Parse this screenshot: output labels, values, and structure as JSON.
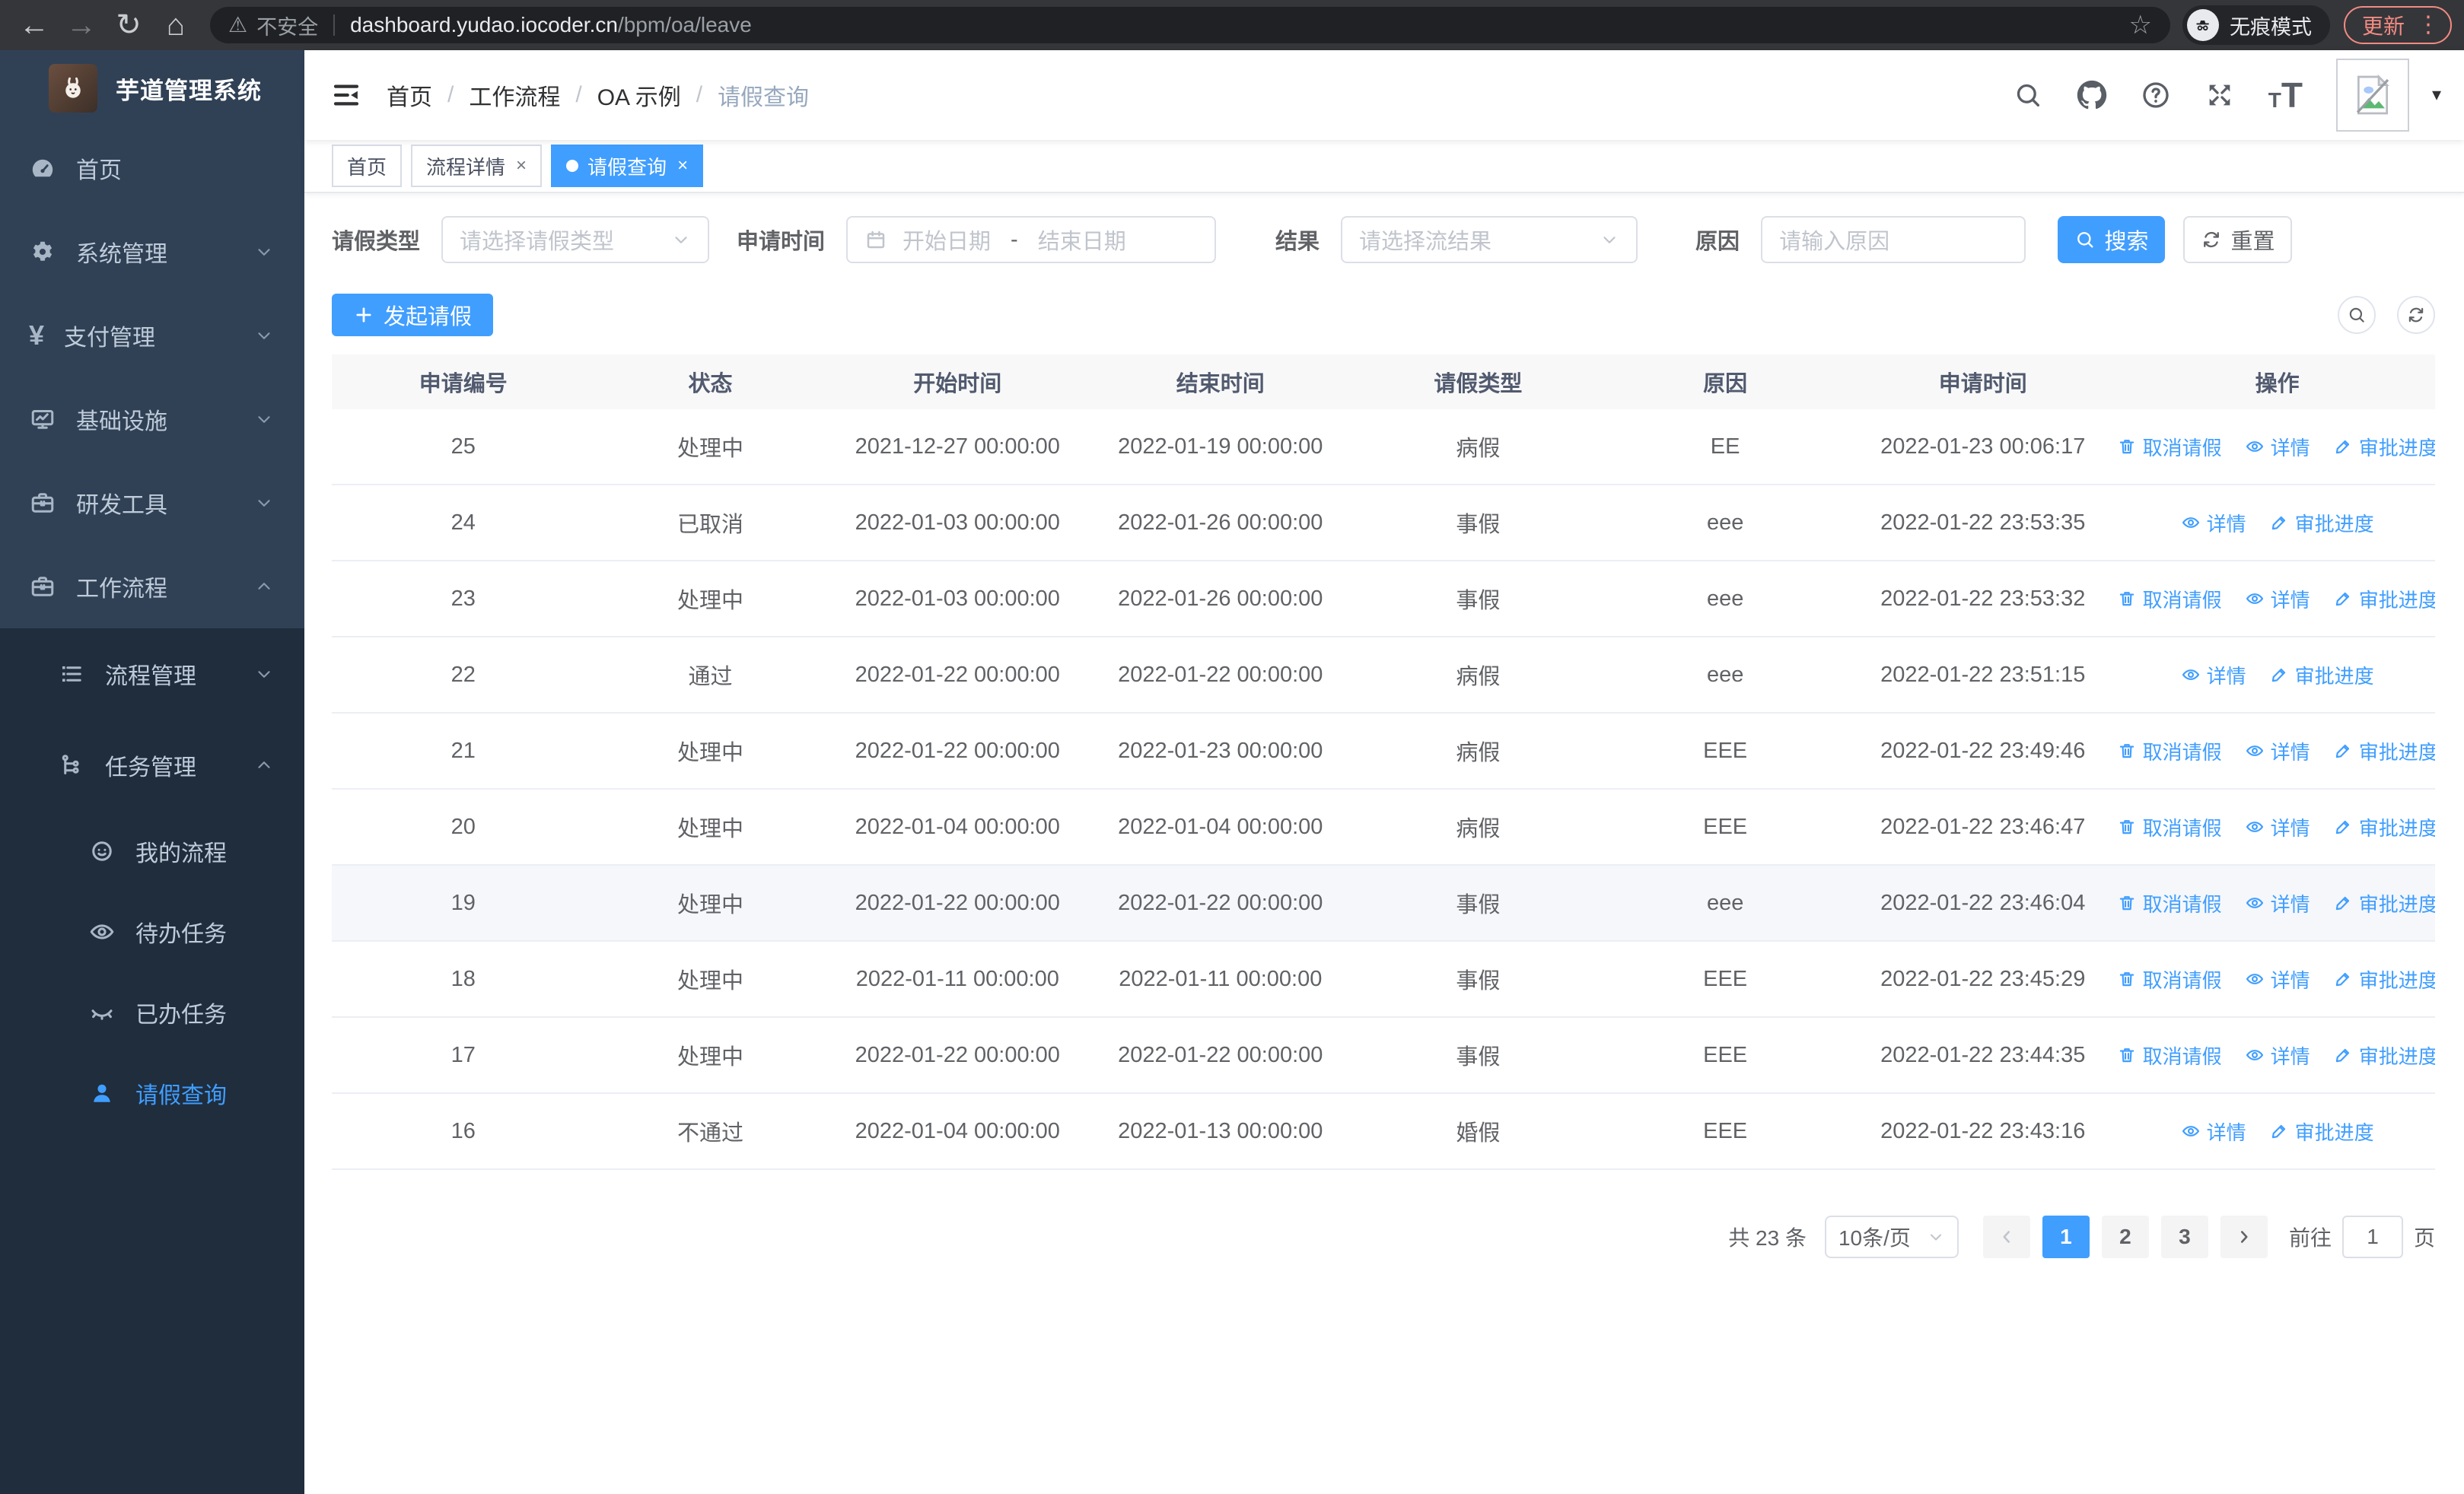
{
  "browser": {
    "security_warning": "不安全",
    "url_host": "dashboard.yudao.iocoder.cn",
    "url_path": "/bpm/oa/leave",
    "incognito_label": "无痕模式",
    "update_button": "更新"
  },
  "colors": {
    "accent_blue": "#409eff",
    "sidebar_bg": "#304156",
    "sidebar_submenu_bg": "#1f2d3d",
    "chrome_bg": "#35363a",
    "update_salmon": "#f28b82",
    "table_header_bg": "#f8f8f9",
    "row_highlight": "#f5f7fa"
  },
  "sidebar": {
    "title": "芋道管理系统",
    "menu": [
      {
        "key": "home",
        "label": "首页",
        "icon": "dashboard",
        "level": 1
      },
      {
        "key": "system",
        "label": "系统管理",
        "icon": "gear",
        "level": 1,
        "arrow": "down"
      },
      {
        "key": "payment",
        "label": "支付管理",
        "icon": "yen",
        "level": 1,
        "arrow": "down"
      },
      {
        "key": "infrastructure",
        "label": "基础设施",
        "icon": "monitor",
        "level": 1,
        "arrow": "down"
      },
      {
        "key": "dev-tools",
        "label": "研发工具",
        "icon": "briefcase",
        "level": 1,
        "arrow": "down"
      },
      {
        "key": "workflow",
        "label": "工作流程",
        "icon": "briefcase",
        "level": 1,
        "arrow": "up"
      },
      {
        "key": "process-mgmt",
        "label": "流程管理",
        "icon": "list",
        "level": 2,
        "arrow": "down",
        "dark": true
      },
      {
        "key": "task-mgmt",
        "label": "任务管理",
        "icon": "tree",
        "level": 2,
        "arrow": "up",
        "dark": true
      },
      {
        "key": "my-process",
        "label": "我的流程",
        "icon": "face",
        "level": 3,
        "dark": true
      },
      {
        "key": "todo-tasks",
        "label": "待办任务",
        "icon": "eye",
        "level": 3,
        "dark": true
      },
      {
        "key": "done-tasks",
        "label": "已办任务",
        "icon": "eye-closed",
        "level": 3,
        "dark": true
      },
      {
        "key": "leave-query",
        "label": "请假查询",
        "icon": "user",
        "level": 3,
        "dark": true,
        "active": true
      }
    ]
  },
  "header": {
    "breadcrumb": [
      "首页",
      "工作流程",
      "OA 示例",
      "请假查询"
    ],
    "breadcrumb_separator": "/"
  },
  "tags": [
    {
      "key": "home",
      "label": "首页",
      "closable": false,
      "active": false
    },
    {
      "key": "process-detail",
      "label": "流程详情",
      "closable": true,
      "active": false
    },
    {
      "key": "leave-query",
      "label": "请假查询",
      "closable": true,
      "active": true
    }
  ],
  "filters": {
    "leave_type_label": "请假类型",
    "leave_type_placeholder": "请选择请假类型",
    "apply_time_label": "申请时间",
    "date_start_placeholder": "开始日期",
    "date_separator": "-",
    "date_end_placeholder": "结束日期",
    "result_label": "结果",
    "result_placeholder": "请选择流结果",
    "reason_label": "原因",
    "reason_placeholder": "请输入原因",
    "search_button": "搜索",
    "reset_button": "重置"
  },
  "toolbar": {
    "create_button": "发起请假"
  },
  "table": {
    "columns": [
      "申请编号",
      "状态",
      "开始时间",
      "结束时间",
      "请假类型",
      "原因",
      "申请时间",
      "操作"
    ],
    "action_labels": {
      "cancel": "取消请假",
      "detail": "详情",
      "progress": "审批进度"
    },
    "rows": [
      {
        "id": "25",
        "status": "处理中",
        "start": "2021-12-27 00:00:00",
        "end": "2022-01-19 00:00:00",
        "type": "病假",
        "reason": "EE",
        "apply_time": "2022-01-23 00:06:17",
        "actions": [
          "cancel",
          "detail",
          "progress"
        ],
        "highlight": false
      },
      {
        "id": "24",
        "status": "已取消",
        "start": "2022-01-03 00:00:00",
        "end": "2022-01-26 00:00:00",
        "type": "事假",
        "reason": "eee",
        "apply_time": "2022-01-22 23:53:35",
        "actions": [
          "detail",
          "progress"
        ],
        "highlight": false
      },
      {
        "id": "23",
        "status": "处理中",
        "start": "2022-01-03 00:00:00",
        "end": "2022-01-26 00:00:00",
        "type": "事假",
        "reason": "eee",
        "apply_time": "2022-01-22 23:53:32",
        "actions": [
          "cancel",
          "detail",
          "progress"
        ],
        "highlight": false
      },
      {
        "id": "22",
        "status": "通过",
        "start": "2022-01-22 00:00:00",
        "end": "2022-01-22 00:00:00",
        "type": "病假",
        "reason": "eee",
        "apply_time": "2022-01-22 23:51:15",
        "actions": [
          "detail",
          "progress"
        ],
        "highlight": false
      },
      {
        "id": "21",
        "status": "处理中",
        "start": "2022-01-22 00:00:00",
        "end": "2022-01-23 00:00:00",
        "type": "病假",
        "reason": "EEE",
        "apply_time": "2022-01-22 23:49:46",
        "actions": [
          "cancel",
          "detail",
          "progress"
        ],
        "highlight": false
      },
      {
        "id": "20",
        "status": "处理中",
        "start": "2022-01-04 00:00:00",
        "end": "2022-01-04 00:00:00",
        "type": "病假",
        "reason": "EEE",
        "apply_time": "2022-01-22 23:46:47",
        "actions": [
          "cancel",
          "detail",
          "progress"
        ],
        "highlight": false
      },
      {
        "id": "19",
        "status": "处理中",
        "start": "2022-01-22 00:00:00",
        "end": "2022-01-22 00:00:00",
        "type": "事假",
        "reason": "eee",
        "apply_time": "2022-01-22 23:46:04",
        "actions": [
          "cancel",
          "detail",
          "progress"
        ],
        "highlight": true
      },
      {
        "id": "18",
        "status": "处理中",
        "start": "2022-01-11 00:00:00",
        "end": "2022-01-11 00:00:00",
        "type": "事假",
        "reason": "EEE",
        "apply_time": "2022-01-22 23:45:29",
        "actions": [
          "cancel",
          "detail",
          "progress"
        ],
        "highlight": false
      },
      {
        "id": "17",
        "status": "处理中",
        "start": "2022-01-22 00:00:00",
        "end": "2022-01-22 00:00:00",
        "type": "事假",
        "reason": "EEE",
        "apply_time": "2022-01-22 23:44:35",
        "actions": [
          "cancel",
          "detail",
          "progress"
        ],
        "highlight": false
      },
      {
        "id": "16",
        "status": "不通过",
        "start": "2022-01-04 00:00:00",
        "end": "2022-01-13 00:00:00",
        "type": "婚假",
        "reason": "EEE",
        "apply_time": "2022-01-22 23:43:16",
        "actions": [
          "detail",
          "progress"
        ],
        "highlight": false
      }
    ]
  },
  "pagination": {
    "total_text": "共 23 条",
    "page_size": "10条/页",
    "pages": [
      "1",
      "2",
      "3"
    ],
    "current_page": "1",
    "goto_label": "前往",
    "goto_value": "1",
    "page_unit": "页"
  }
}
